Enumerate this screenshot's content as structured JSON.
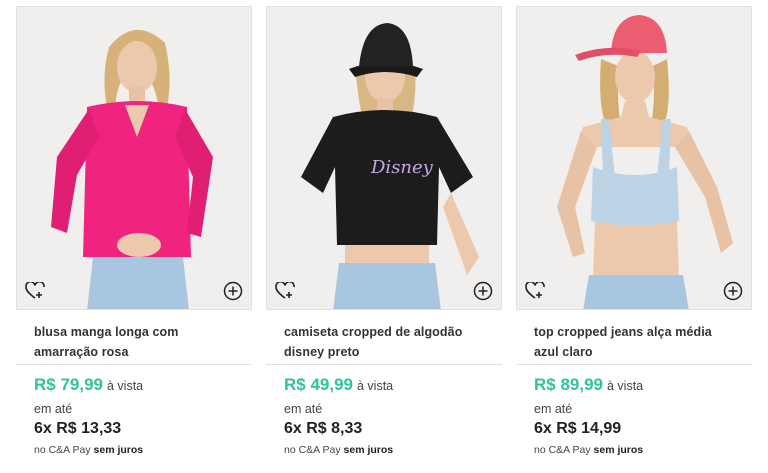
{
  "products": [
    {
      "name": "blusa manga longa com amarração rosa",
      "price": "R$ 79,99",
      "cash_label": "à vista",
      "installment_prefix": "em até",
      "installment": "6x R$ 13,33",
      "pay_text": "no C&A Pay",
      "pay_bold": "sem juros",
      "garment_color": "#f0237f",
      "icons": [
        "heart-plus-icon",
        "plus-circle-icon"
      ]
    },
    {
      "name": "camiseta cropped de algodão disney preto",
      "price": "R$ 49,99",
      "cash_label": "à vista",
      "installment_prefix": "em até",
      "installment": "6x R$ 8,33",
      "pay_text": "no C&A Pay",
      "pay_bold": "sem juros",
      "garment_color": "#1c1c1c",
      "print_text": "Disney",
      "icons": [
        "heart-plus-icon",
        "plus-circle-icon"
      ]
    },
    {
      "name": "top cropped jeans alça média azul claro",
      "price": "R$ 89,99",
      "cash_label": "à vista",
      "installment_prefix": "em até",
      "installment": "6x R$ 14,99",
      "pay_text": "no C&A Pay",
      "pay_bold": "sem juros",
      "garment_color": "#bcd3e6",
      "icons": [
        "heart-plus-icon",
        "plus-circle-icon"
      ]
    }
  ],
  "colors": {
    "price": "#2fc39d",
    "jeans": "#a9c6e0",
    "cap": "#ec5d72"
  }
}
